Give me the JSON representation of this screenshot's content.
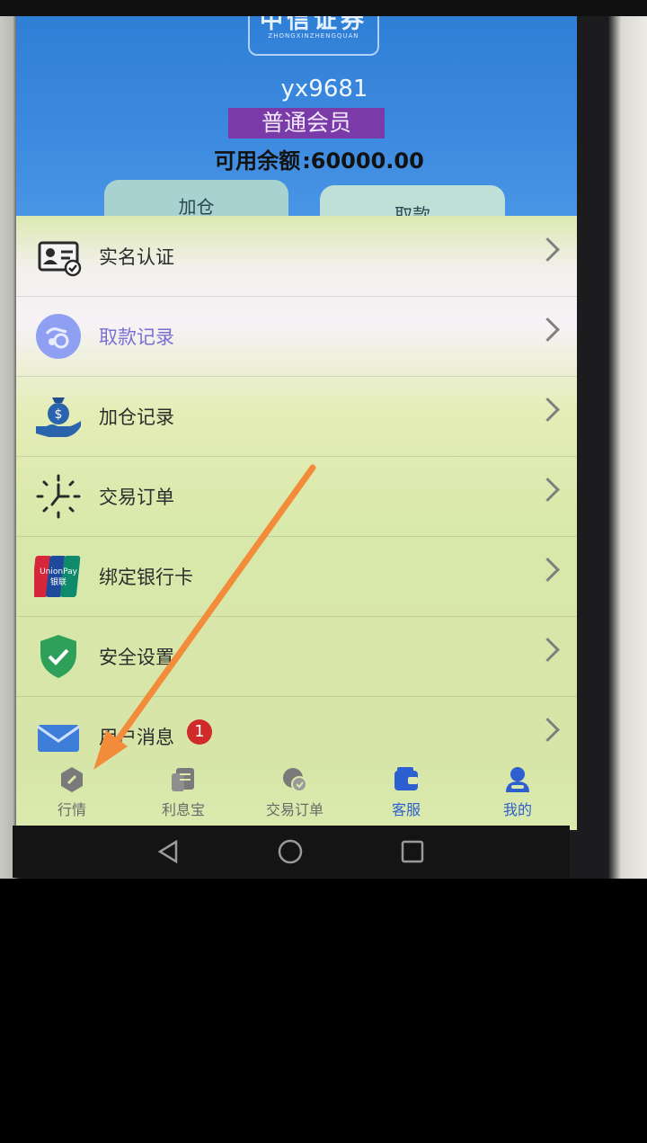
{
  "header": {
    "logo_main": "中信证券",
    "logo_sub": "ZHONGXINZHENGQUAN",
    "username": "yx9681",
    "member_level": "普通会员",
    "balance_label": "可用余额",
    "balance_value": ":60000.00",
    "add_button_label": "加仓",
    "withdraw_button_label": "取款"
  },
  "menu": {
    "items": [
      {
        "label": "实名认证",
        "icon": "id-card-icon"
      },
      {
        "label": "取款记录",
        "icon": "withdraw-record-icon"
      },
      {
        "label": "加仓记录",
        "icon": "money-bag-hand-icon"
      },
      {
        "label": "交易订单",
        "icon": "clock-icon"
      },
      {
        "label": "绑定银行卡",
        "icon": "unionpay-card-icon"
      },
      {
        "label": "安全设置",
        "icon": "shield-check-icon"
      },
      {
        "label": "用户消息",
        "icon": "message-icon",
        "badge": "1"
      }
    ]
  },
  "tabbar": {
    "tabs": [
      {
        "label": "行情",
        "icon": "market-icon"
      },
      {
        "label": "利息宝",
        "icon": "interest-icon"
      },
      {
        "label": "交易订单",
        "icon": "orders-icon"
      },
      {
        "label": "客服",
        "icon": "service-icon"
      },
      {
        "label": "我的",
        "icon": "profile-icon"
      }
    ],
    "active_color": "#2d5fd0"
  },
  "colors": {
    "header_blue": "#3d8be0",
    "member_badge": "#7a3aa8",
    "annotation_arrow": "#f28c3a"
  }
}
